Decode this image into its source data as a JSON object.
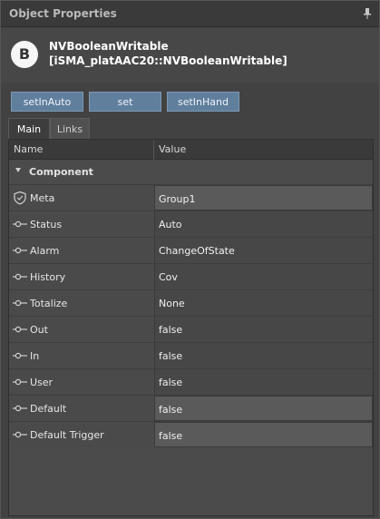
{
  "panel": {
    "title": "Object Properties",
    "pin_icon": "pin-icon"
  },
  "object": {
    "badge_letter": "B",
    "name_line1": "NVBooleanWritable",
    "name_line2": "[iSMA_platAAC20::NVBooleanWritable]"
  },
  "actions": [
    {
      "label": "setInAuto"
    },
    {
      "label": "set"
    },
    {
      "label": "setInHand"
    }
  ],
  "tabs": [
    {
      "label": "Main",
      "active": true
    },
    {
      "label": "Links",
      "active": false
    }
  ],
  "grid": {
    "columns": {
      "name": "Name",
      "value": "Value"
    },
    "section": "Component",
    "rows": [
      {
        "name": "Meta",
        "value": "Group1",
        "icon": "shield-icon"
      },
      {
        "name": "Status",
        "value": "Auto",
        "icon": "slot-icon"
      },
      {
        "name": "Alarm",
        "value": "ChangeOfState",
        "icon": "slot-icon"
      },
      {
        "name": "History",
        "value": "Cov",
        "icon": "slot-icon"
      },
      {
        "name": "Totalize",
        "value": "None",
        "icon": "slot-icon"
      },
      {
        "name": "Out",
        "value": "false",
        "icon": "slot-icon"
      },
      {
        "name": "In",
        "value": "false",
        "icon": "slot-icon"
      },
      {
        "name": "User",
        "value": "false",
        "icon": "slot-icon"
      },
      {
        "name": "Default",
        "value": "false",
        "icon": "slot-icon"
      },
      {
        "name": "Default Trigger",
        "value": "false",
        "icon": "slot-icon"
      }
    ]
  },
  "colors": {
    "action_button": "#607f9d",
    "panel_bg": "#424242"
  }
}
